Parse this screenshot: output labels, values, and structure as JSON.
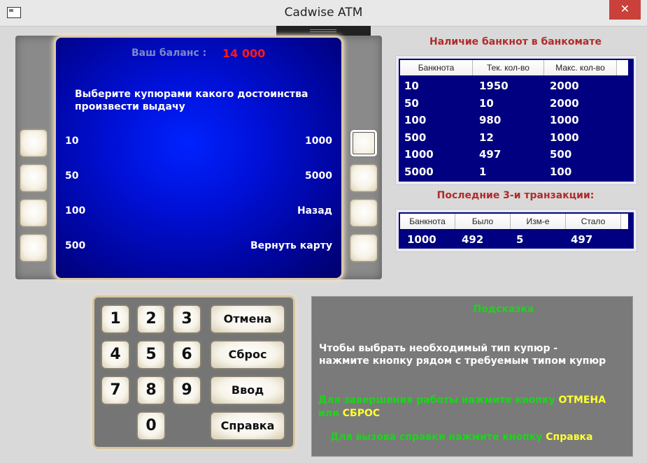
{
  "window": {
    "title": "Cadwise ATM",
    "close_glyph": "✕"
  },
  "screen": {
    "balance_label": "Ваш баланс :",
    "balance_value": "14 000",
    "prompt_line1": "Выберите купюрами какого достоинства",
    "prompt_line2": "произвести выдачу",
    "left_options": [
      "10",
      "50",
      "100",
      "500"
    ],
    "right_options": [
      "1000",
      "5000",
      "Назад",
      "Вернуть карту"
    ]
  },
  "stock": {
    "title": "Наличие банкнот в банкомате",
    "headers": [
      "Банкнота",
      "Тек. кол-во",
      "Макс. кол-во"
    ],
    "rows": [
      [
        "10",
        "1950",
        "2000"
      ],
      [
        "50",
        "10",
        "2000"
      ],
      [
        "100",
        "980",
        "1000"
      ],
      [
        "500",
        "12",
        "1000"
      ],
      [
        "1000",
        "497",
        "500"
      ],
      [
        "5000",
        "1",
        "100"
      ]
    ]
  },
  "transactions": {
    "title": "Последние 3-и транзакции:",
    "headers": [
      "Банкнота",
      "Было",
      "Изм-е",
      "Стало"
    ],
    "rows": [
      [
        "1000",
        "492",
        "5",
        "497"
      ]
    ]
  },
  "keypad": {
    "digits": [
      "1",
      "2",
      "3",
      "4",
      "5",
      "6",
      "7",
      "8",
      "9",
      "0"
    ],
    "cancel": "Отмена",
    "reset": "Сброс",
    "enter": "Ввод",
    "help": "Справка"
  },
  "hint": {
    "title": "Подсказка",
    "main_line1": "Чтобы выбрать необходимый тип купюр -",
    "main_line2": "нажмите кнопку рядом с требуемым типом купюр",
    "finish_text": "Для завершения работы нажмите кнопку ",
    "finish_cancel": "ОТМЕНА",
    "finish_or": "или ",
    "finish_reset": "СБРОС",
    "help_text": "Для вызова справки нажмите кнопку ",
    "help_word": "Справка"
  },
  "colors": {
    "screen_blue": "#0010d6",
    "balance_red": "#ff1a1a",
    "hint_green": "#19d619",
    "hint_yellow": "#ffff33",
    "section_title_red": "#b22a2a"
  }
}
